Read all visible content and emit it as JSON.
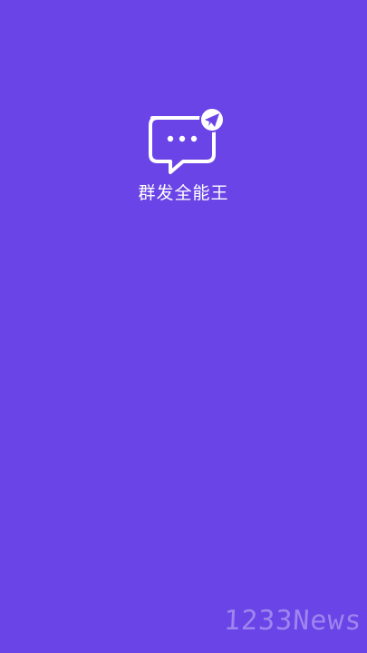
{
  "app": {
    "name": "群发全能王",
    "icon": "message-send-icon",
    "background_color": "#6A44E6"
  },
  "watermark": {
    "text": "1233News"
  }
}
